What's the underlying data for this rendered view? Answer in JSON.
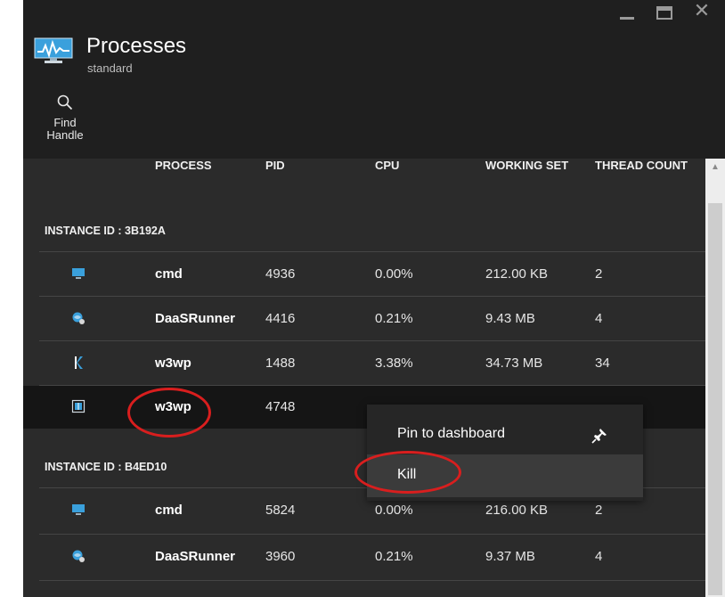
{
  "window": {
    "title": "Processes",
    "subtitle": "standard"
  },
  "commands": {
    "find_handle": [
      "Find",
      "Handle"
    ]
  },
  "columns": [
    "PROCESS",
    "PID",
    "CPU",
    "WORKING SET",
    "THREAD COUNT"
  ],
  "groups": [
    {
      "header": "INSTANCE ID : 3B192A",
      "rows": [
        {
          "icon": "cmd-icon",
          "process": "cmd",
          "pid": "4936",
          "cpu": "0.00%",
          "working_set": "212.00 KB",
          "threads": "2"
        },
        {
          "icon": "daas-runner-icon",
          "process": "DaaSRunner",
          "pid": "4416",
          "cpu": "0.21%",
          "working_set": "9.43 MB",
          "threads": "4"
        },
        {
          "icon": "kudu-icon",
          "process": "w3wp",
          "pid": "1488",
          "cpu": "3.38%",
          "working_set": "34.73 MB",
          "threads": "34"
        },
        {
          "icon": "w3wp-icon",
          "process": "w3wp",
          "pid": "4748",
          "cpu": "",
          "working_set": "",
          "threads": ""
        }
      ]
    },
    {
      "header": "INSTANCE ID : B4ED10",
      "rows": [
        {
          "icon": "cmd-icon",
          "process": "cmd",
          "pid": "5824",
          "cpu": "0.00%",
          "working_set": "216.00 KB",
          "threads": "2"
        },
        {
          "icon": "daas-runner-icon",
          "process": "DaaSRunner",
          "pid": "3960",
          "cpu": "0.21%",
          "working_set": "9.37 MB",
          "threads": "4"
        }
      ]
    }
  ],
  "context_menu": {
    "items": [
      "Pin to dashboard",
      "Kill"
    ]
  },
  "colors": {
    "window_bg": "#2b2b2b",
    "header_bg": "#1f1f1f",
    "selected_row": "#151515",
    "annotation": "#d91e1e"
  }
}
